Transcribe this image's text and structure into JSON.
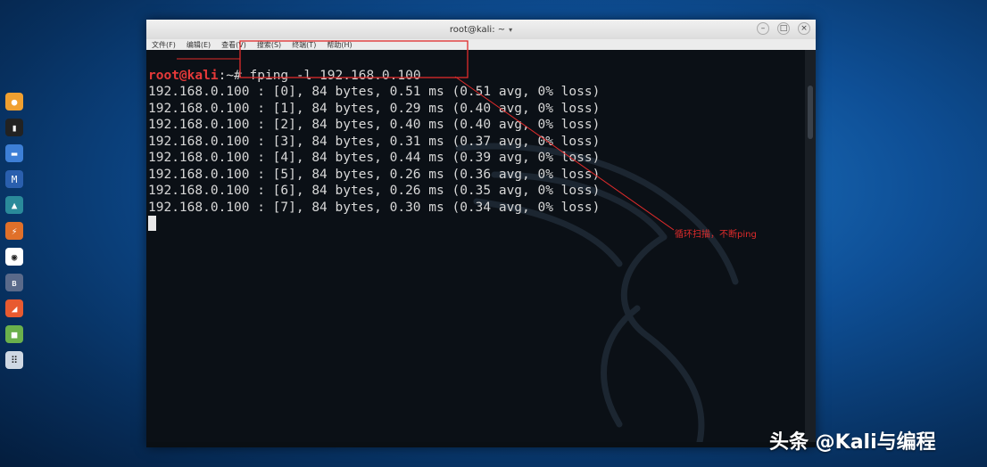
{
  "window": {
    "title": "root@kali: ~",
    "menu": [
      "文件(F)",
      "编辑(E)",
      "查看(V)",
      "搜索(S)",
      "终端(T)",
      "帮助(H)"
    ]
  },
  "terminal": {
    "prompt_user": "root@kali",
    "prompt_path": ":~# ",
    "command": "fping -l 192.168.0.100",
    "output": [
      "192.168.0.100 : [0], 84 bytes, 0.51 ms (0.51 avg, 0% loss)",
      "192.168.0.100 : [1], 84 bytes, 0.29 ms (0.40 avg, 0% loss)",
      "192.168.0.100 : [2], 84 bytes, 0.40 ms (0.40 avg, 0% loss)",
      "192.168.0.100 : [3], 84 bytes, 0.31 ms (0.37 avg, 0% loss)",
      "192.168.0.100 : [4], 84 bytes, 0.44 ms (0.39 avg, 0% loss)",
      "192.168.0.100 : [5], 84 bytes, 0.26 ms (0.36 avg, 0% loss)",
      "192.168.0.100 : [6], 84 bytes, 0.26 ms (0.35 avg, 0% loss)",
      "192.168.0.100 : [7], 84 bytes, 0.30 ms (0.34 avg, 0% loss)"
    ]
  },
  "annotation": {
    "text": "循环扫描，不断ping",
    "color": "#e02b2b"
  },
  "watermark": "头条 @Kali与编程",
  "dock": [
    {
      "icon": "firefox-icon",
      "color": "#f0a030"
    },
    {
      "icon": "terminal-icon",
      "color": "#222222"
    },
    {
      "icon": "files-icon",
      "color": "#3d7fd6"
    },
    {
      "icon": "metasploit-icon",
      "color": "#2a5fae"
    },
    {
      "icon": "armitage-icon",
      "color": "#2a8a9a"
    },
    {
      "icon": "burpsuite-icon",
      "color": "#e0702a"
    },
    {
      "icon": "maltego-icon",
      "color": "#ffffff"
    },
    {
      "icon": "beef-icon",
      "color": "#5a6a8a"
    },
    {
      "icon": "faraday-icon",
      "color": "#e85a30"
    },
    {
      "icon": "leafpad-icon",
      "color": "#6ab04c"
    },
    {
      "icon": "show-apps-icon",
      "color": "#cfd8e3"
    }
  ]
}
